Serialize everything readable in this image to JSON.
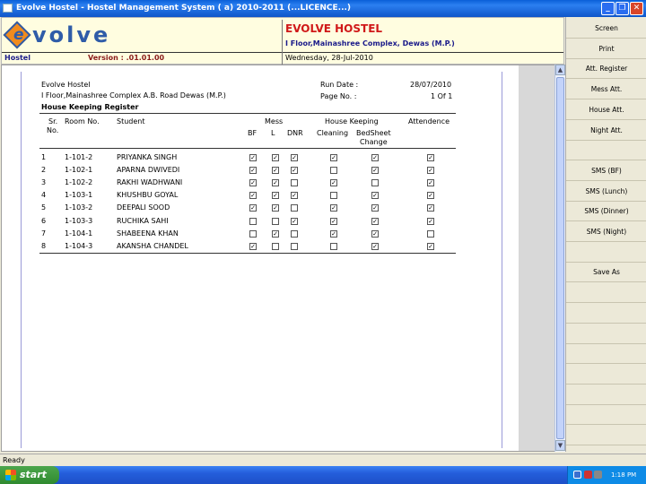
{
  "window": {
    "title": "Evolve Hostel - Hostel Management System ( a) 2010-2011 (...LICENCE...)"
  },
  "header": {
    "logo_text": "volve",
    "logo_letter": "e",
    "hostel_name": "EVOLVE HOSTEL",
    "hostel_address": "I Floor,Mainashree Complex, Dewas (M.P.)",
    "module": "Hostel",
    "version": "Version : .01.01.00",
    "date": "Wednesday, 28-Jul-2010"
  },
  "report": {
    "org": "Evolve Hostel",
    "address": "I Floor,Mainashree Complex A.B. Road Dewas (M.P.)",
    "title": "House Keeping Register",
    "run_date_label": "Run Date :",
    "run_date": "28/07/2010",
    "page_label": "Page No. :",
    "page_value": "1 Of 1",
    "columns": {
      "sr": "Sr.",
      "no": "No.",
      "room": "Room No.",
      "student": "Student",
      "mess": "Mess",
      "bf": "BF",
      "l": "L",
      "dnr": "DNR",
      "housekeeping": "House Keeping",
      "cleaning": "Cleaning",
      "bedsheet1": "BedSheet",
      "bedsheet2": "Change",
      "attendence": "Attendence"
    },
    "rows": [
      {
        "sr": "1",
        "room": "1-101-2",
        "student": "PRIYANKA SINGH",
        "bf": true,
        "l": true,
        "dnr": true,
        "cleaning": true,
        "bedsheet": true,
        "attendence": true
      },
      {
        "sr": "2",
        "room": "1-102-1",
        "student": "APARNA  DWIVEDI",
        "bf": true,
        "l": true,
        "dnr": true,
        "cleaning": false,
        "bedsheet": true,
        "attendence": true
      },
      {
        "sr": "3",
        "room": "1-102-2",
        "student": "RAKHI WADHWANI",
        "bf": true,
        "l": true,
        "dnr": false,
        "cleaning": true,
        "bedsheet": false,
        "attendence": true
      },
      {
        "sr": "4",
        "room": "1-103-1",
        "student": "KHUSHBU  GOYAL",
        "bf": true,
        "l": true,
        "dnr": true,
        "cleaning": false,
        "bedsheet": true,
        "attendence": true
      },
      {
        "sr": "5",
        "room": "1-103-2",
        "student": "DEEPALI  SOOD",
        "bf": true,
        "l": true,
        "dnr": false,
        "cleaning": true,
        "bedsheet": true,
        "attendence": true
      },
      {
        "sr": "6",
        "room": "1-103-3",
        "student": "RUCHIKA  SAHI",
        "bf": false,
        "l": false,
        "dnr": true,
        "cleaning": true,
        "bedsheet": true,
        "attendence": true
      },
      {
        "sr": "7",
        "room": "1-104-1",
        "student": "SHABEENA KHAN",
        "bf": false,
        "l": true,
        "dnr": false,
        "cleaning": true,
        "bedsheet": true,
        "attendence": false
      },
      {
        "sr": "8",
        "room": "1-104-3",
        "student": "AKANSHA CHANDEL",
        "bf": true,
        "l": false,
        "dnr": false,
        "cleaning": false,
        "bedsheet": true,
        "attendence": true
      }
    ]
  },
  "sidebar": {
    "items": [
      "Screen",
      "Print",
      "Att. Register",
      "Mess Att.",
      "House Att.",
      "Night Att.",
      "",
      "SMS (BF)",
      "SMS (Lunch)",
      "SMS (Dinner)",
      "SMS (Night)",
      "",
      "Save As"
    ]
  },
  "status": {
    "text": "Ready"
  },
  "taskbar": {
    "start_label": "start",
    "clock": "1:18 PM"
  }
}
